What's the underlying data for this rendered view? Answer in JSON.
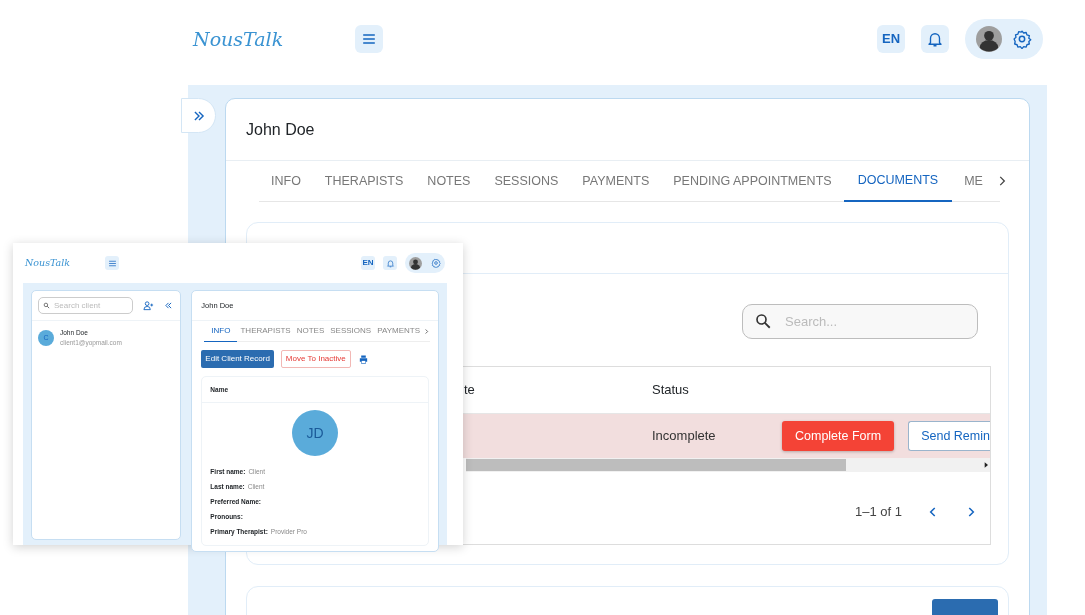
{
  "header": {
    "logo": "NousTalk",
    "language": "EN"
  },
  "client": {
    "name": "John Doe"
  },
  "tabs": [
    {
      "label": "INFO",
      "selected": false
    },
    {
      "label": "THERAPISTS",
      "selected": false
    },
    {
      "label": "NOTES",
      "selected": false
    },
    {
      "label": "SESSIONS",
      "selected": false
    },
    {
      "label": "PAYMENTS",
      "selected": false
    },
    {
      "label": "PENDING APPOINTMENTS",
      "selected": false
    },
    {
      "label": "DOCUMENTS",
      "selected": true
    },
    {
      "label": "ME",
      "selected": false
    }
  ],
  "documents": {
    "search": {
      "placeholder": "Search..."
    },
    "table": {
      "columns": [
        "te",
        "Status"
      ],
      "rows": [
        {
          "status": "Incomplete",
          "highlighted": true,
          "actions": [
            {
              "label": "Complete Form",
              "kind": "primary"
            },
            {
              "label": "Send Remin",
              "kind": "outline"
            }
          ]
        }
      ]
    },
    "pagination": "1–1 of 1"
  },
  "inset": {
    "logo": "NousTalk",
    "language": "EN",
    "search": {
      "placeholder": "Search client"
    },
    "clients": [
      {
        "initial": "C",
        "name": "John Doe",
        "email": "client1@yopmail.com"
      }
    ],
    "client_name": "John Doe",
    "tabs": [
      {
        "label": "INFO",
        "selected": true
      },
      {
        "label": "THERAPISTS",
        "selected": false
      },
      {
        "label": "NOTES",
        "selected": false
      },
      {
        "label": "SESSIONS",
        "selected": false
      },
      {
        "label": "PAYMENTS",
        "selected": false
      }
    ],
    "actions": [
      {
        "label": "Edit Client Record",
        "kind": "primary"
      },
      {
        "label": "Move To Inactive",
        "kind": "danger"
      }
    ],
    "card_title": "Name",
    "avatar": "JD",
    "fields": [
      {
        "label": "First name:",
        "value": "Client"
      },
      {
        "label": "Last name:",
        "value": "Client"
      },
      {
        "label": "Preferred Name:"
      },
      {
        "label": "Pronouns:"
      },
      {
        "label": "Primary Therapist:",
        "value": "Provider Pro"
      }
    ]
  }
}
